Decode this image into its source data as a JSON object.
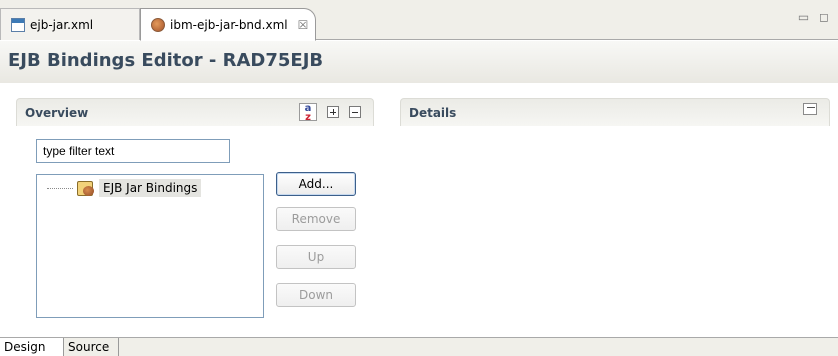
{
  "tabs": [
    {
      "label": "ejb-jar.xml",
      "icon": "xml-file-icon",
      "active": false
    },
    {
      "label": "ibm-ejb-jar-bnd.xml",
      "icon": "ejb-bean-icon",
      "active": true,
      "close": "☒"
    }
  ],
  "window_controls": "▭ ◻",
  "editor_title": "EJB Bindings Editor - RAD75EJB",
  "overview": {
    "title": "Overview",
    "filter_placeholder": "type filter text",
    "tree": [
      {
        "label": "EJB Jar Bindings",
        "icon": "ejb-jar-bindings-icon"
      }
    ],
    "buttons": {
      "add": "Add...",
      "remove": "Remove",
      "up": "Up",
      "down": "Down"
    }
  },
  "details": {
    "title": "Details"
  },
  "bottom_tabs": [
    {
      "label": "Design",
      "active": true
    },
    {
      "label": "Source",
      "active": false
    }
  ]
}
